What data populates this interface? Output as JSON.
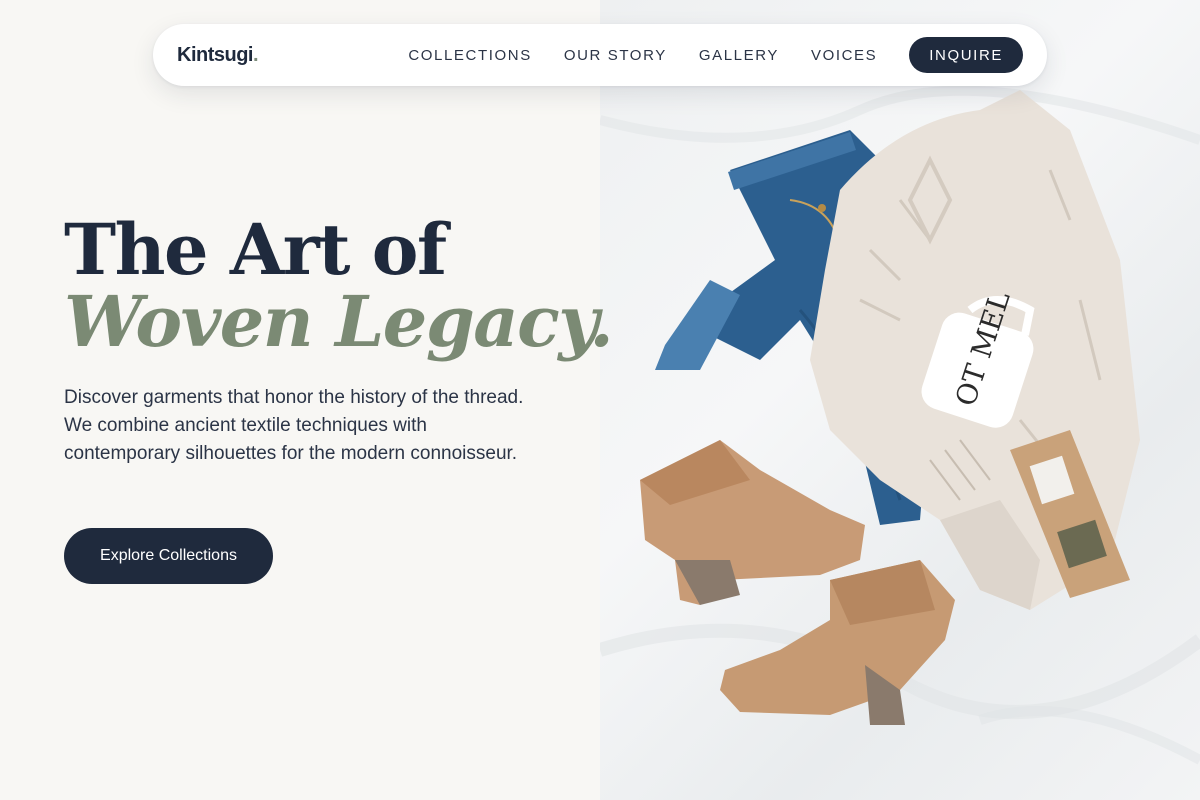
{
  "brand": {
    "name": "Kintsugi",
    "dot": "."
  },
  "nav": {
    "links": [
      "COLLECTIONS",
      "OUR STORY",
      "GALLERY",
      "VOICES"
    ],
    "cta": "INQUIRE"
  },
  "hero": {
    "title_line1": "The Art of",
    "title_line2": "Woven Legacy.",
    "description": "Discover garments that honor the history of the thread. We combine ancient textile techniques with contemporary silhouettes for the modern connoisseur.",
    "button": "Explore Collections"
  },
  "image": {
    "mug_text": "OT MEL"
  },
  "colors": {
    "navy": "#1f2a3d",
    "sage": "#7b8a74",
    "cream": "#f8f7f4"
  }
}
